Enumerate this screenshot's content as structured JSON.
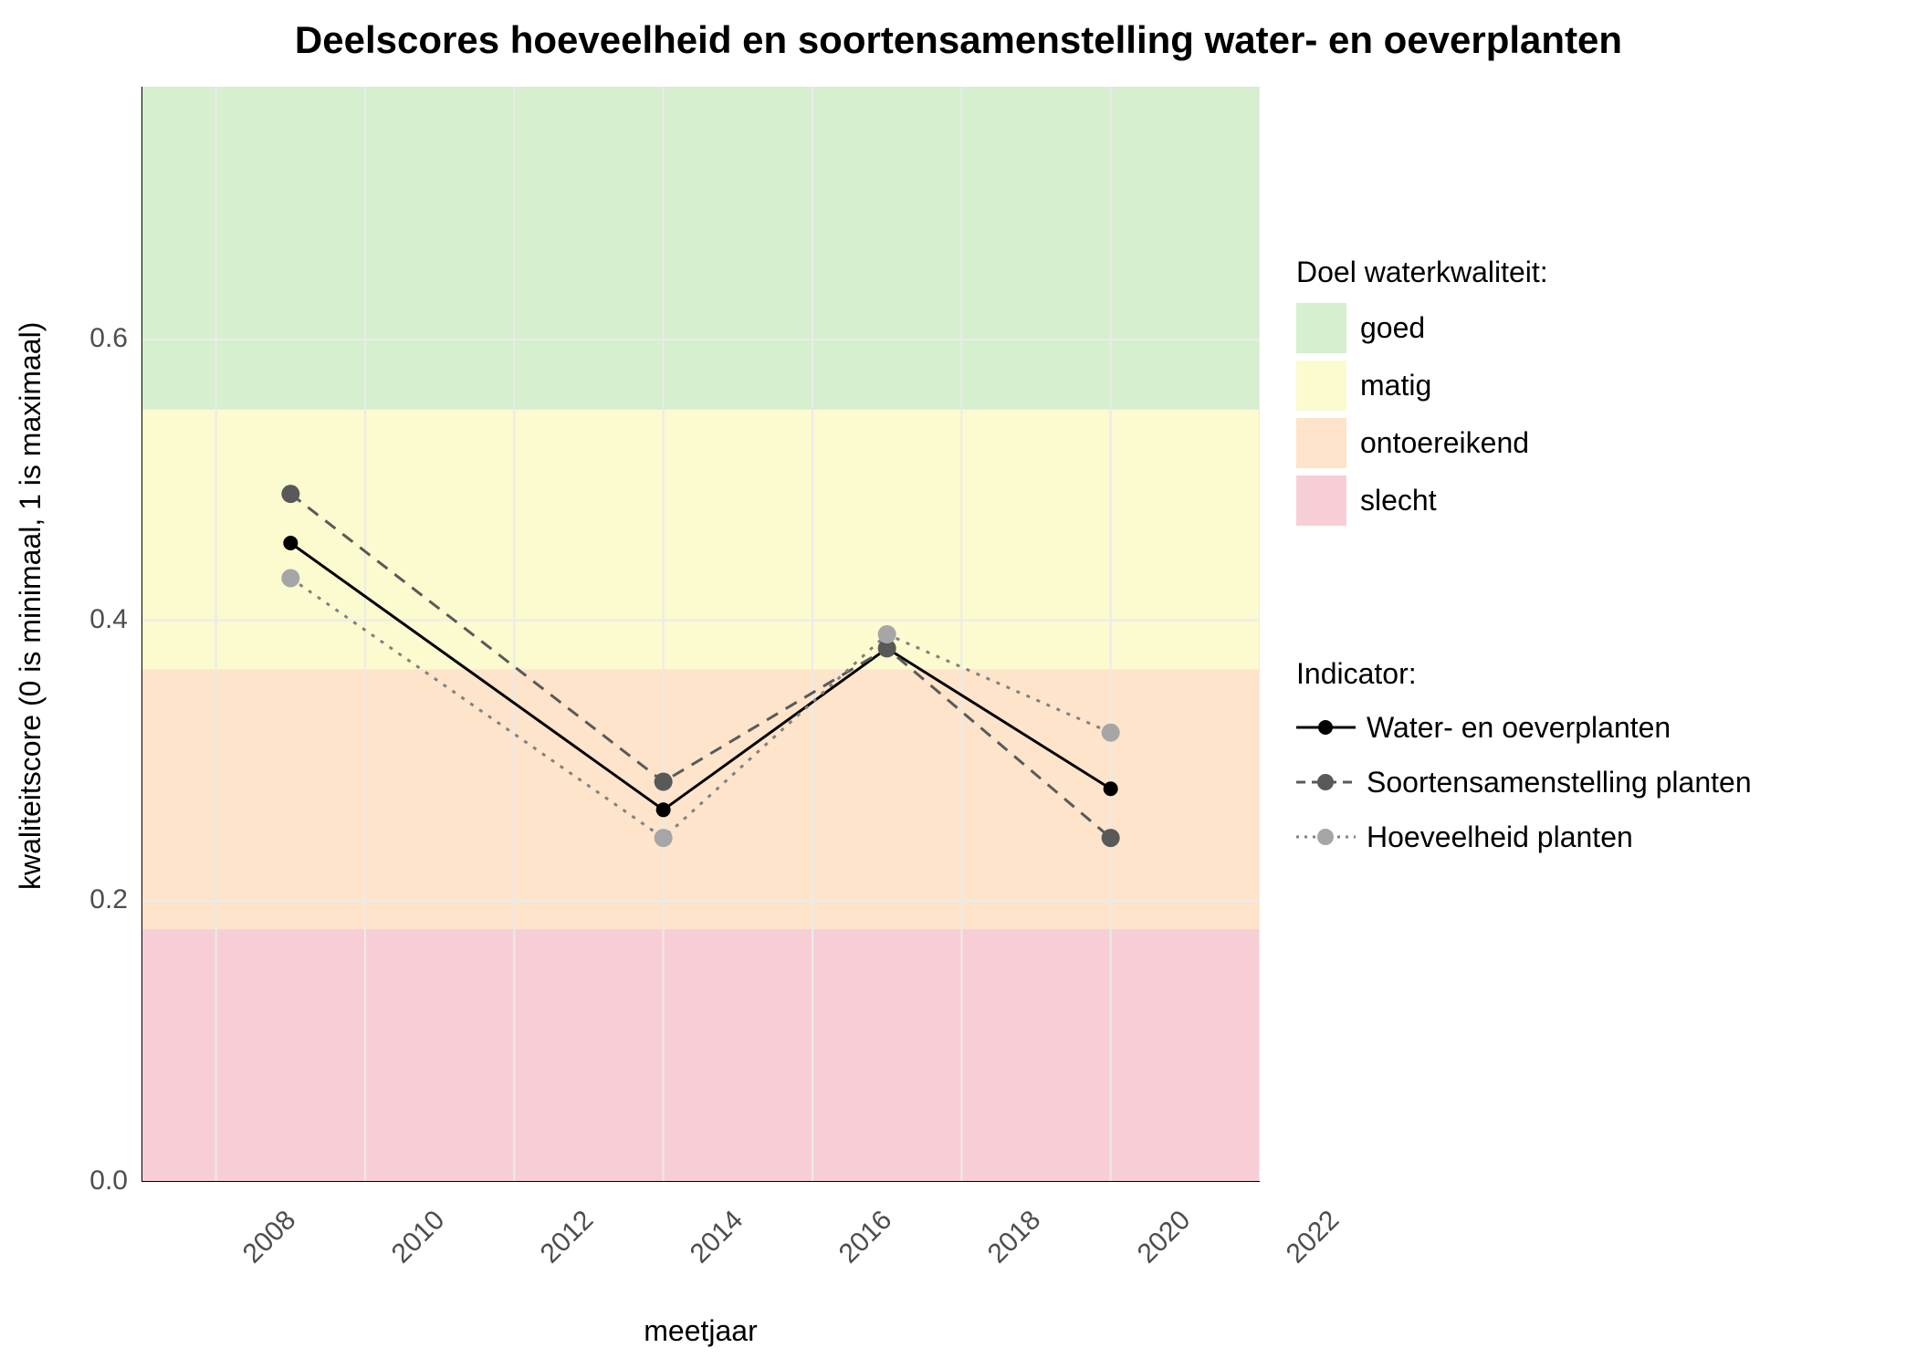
{
  "chart_data": {
    "type": "line",
    "title": "Deelscores hoeveelheid en soortensamenstelling water- en oeverplanten",
    "xlabel": "meetjaar",
    "ylabel": "kwaliteitscore (0 is minimaal, 1 is maximaal)",
    "xlim": [
      2007,
      2022
    ],
    "ylim": [
      0.0,
      0.78
    ],
    "x_ticks": [
      2008,
      2010,
      2012,
      2014,
      2016,
      2018,
      2020,
      2022
    ],
    "y_ticks": [
      0.0,
      0.2,
      0.4,
      0.6
    ],
    "bands": [
      {
        "name": "slecht",
        "ymin": 0.0,
        "ymax": 0.18,
        "color": "#f8ced6"
      },
      {
        "name": "ontoereikend",
        "ymin": 0.18,
        "ymax": 0.365,
        "color": "#fde4ca"
      },
      {
        "name": "matig",
        "ymin": 0.365,
        "ymax": 0.55,
        "color": "#fcfacf"
      },
      {
        "name": "goed",
        "ymin": 0.55,
        "ymax": 0.78,
        "color": "#d5efcf"
      }
    ],
    "series": [
      {
        "name": "Water- en oeverplanten",
        "line_style": "solid",
        "color": "#000000",
        "x": [
          2009,
          2014,
          2017,
          2020
        ],
        "y": [
          0.455,
          0.265,
          0.38,
          0.28
        ]
      },
      {
        "name": "Soortensamenstelling planten",
        "line_style": "dashed",
        "color": "#595959",
        "x": [
          2009,
          2014,
          2017,
          2020
        ],
        "y": [
          0.49,
          0.285,
          0.38,
          0.245
        ]
      },
      {
        "name": "Hoeveelheid planten",
        "line_style": "dotted",
        "color": "#a6a6a6",
        "x": [
          2009,
          2014,
          2017,
          2020
        ],
        "y": [
          0.43,
          0.245,
          0.39,
          0.32
        ]
      }
    ],
    "legend1_title": "Doel waterkwaliteit:",
    "legend1_items": [
      "goed",
      "matig",
      "ontoereikend",
      "slecht"
    ],
    "legend2_title": "Indicator:",
    "legend2_items": [
      "Water- en oeverplanten",
      "Soortensamenstelling planten",
      "Hoeveelheid planten"
    ]
  }
}
